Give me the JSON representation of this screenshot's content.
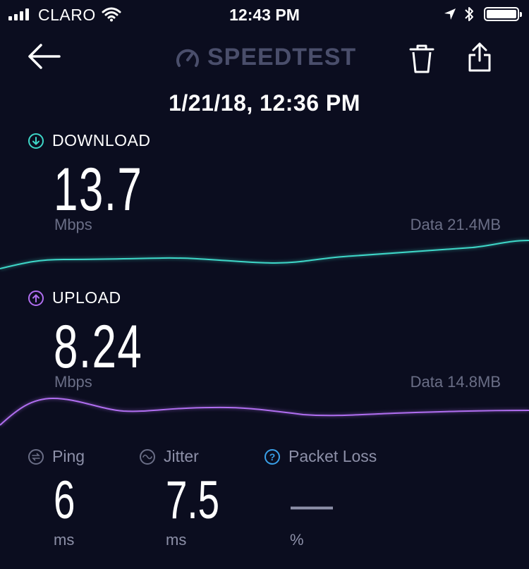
{
  "status_bar": {
    "carrier": "CLARO",
    "time": "12:43 PM"
  },
  "header": {
    "logo_text": "SPEEDTEST"
  },
  "result": {
    "datetime": "1/21/18, 12:36 PM"
  },
  "download": {
    "label": "DOWNLOAD",
    "value": "13.7",
    "unit": "Mbps",
    "data": "Data 21.4MB",
    "color": "#3ed7c8"
  },
  "upload": {
    "label": "UPLOAD",
    "value": "8.24",
    "unit": "Mbps",
    "data": "Data 14.8MB",
    "color": "#b06ef0"
  },
  "ping": {
    "label": "Ping",
    "value": "6",
    "unit": "ms"
  },
  "jitter": {
    "label": "Jitter",
    "value": "7.5",
    "unit": "ms"
  },
  "packet_loss": {
    "label": "Packet Loss",
    "value": "—",
    "unit": "%",
    "icon_color": "#3aa0e8"
  }
}
